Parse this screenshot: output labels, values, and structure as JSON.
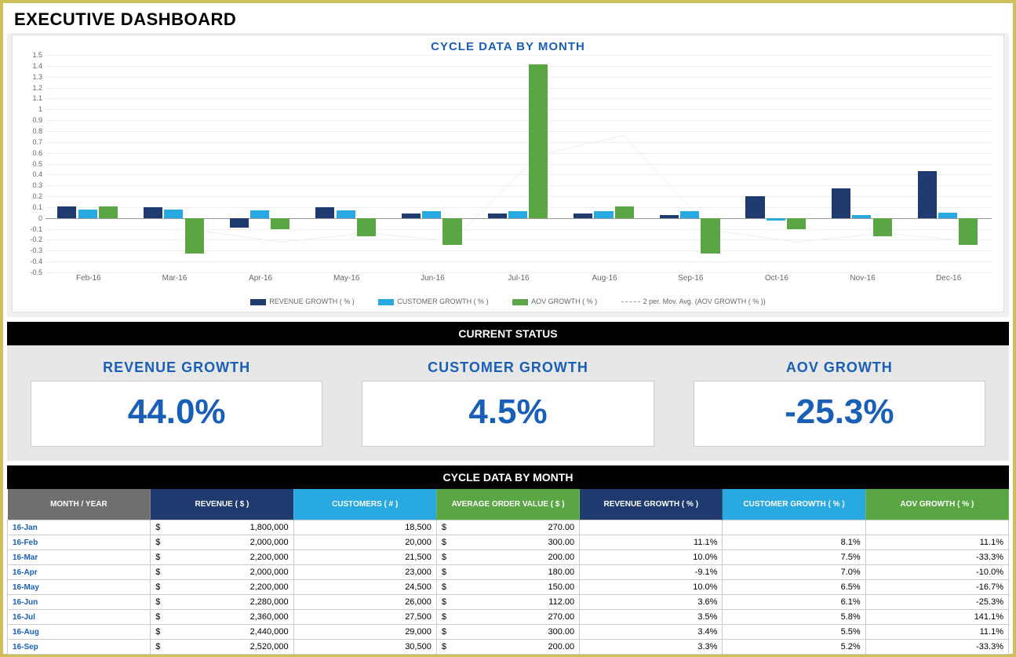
{
  "title": "EXECUTIVE DASHBOARD",
  "section_current": "CURRENT STATUS",
  "section_table": "CYCLE DATA BY MONTH",
  "chart_data": {
    "type": "bar",
    "title": "CYCLE DATA BY MONTH",
    "ylim": [
      -0.5,
      1.5
    ],
    "yticks": [
      -0.5,
      -0.4,
      -0.3,
      -0.2,
      -0.1,
      0,
      0.1,
      0.2,
      0.3,
      0.4,
      0.5,
      0.6,
      0.7,
      0.8,
      0.9,
      1,
      1.1,
      1.2,
      1.3,
      1.4,
      1.5
    ],
    "categories": [
      "Feb-16",
      "Mar-16",
      "Apr-16",
      "May-16",
      "Jun-16",
      "Jul-16",
      "Aug-16",
      "Sep-16",
      "Oct-16",
      "Nov-16",
      "Dec-16"
    ],
    "series": [
      {
        "name": "REVENUE GROWTH  ( % )",
        "color": "#1e3a6e",
        "values": [
          0.11,
          0.1,
          -0.09,
          0.1,
          0.04,
          0.04,
          0.04,
          0.03,
          0.2,
          0.27,
          0.43
        ]
      },
      {
        "name": "CUSTOMER GROWTH  ( % )",
        "color": "#29a9e1",
        "values": [
          0.08,
          0.08,
          0.07,
          0.07,
          0.06,
          0.06,
          0.06,
          0.06,
          -0.02,
          0.03,
          0.05
        ]
      },
      {
        "name": "AOV GROWTH  ( % )",
        "color": "#5aa644",
        "values": [
          0.11,
          -0.33,
          -0.1,
          -0.17,
          -0.25,
          1.41,
          0.11,
          -0.33,
          -0.1,
          -0.17,
          -0.25
        ]
      }
    ],
    "moving_avg": {
      "name": "2 per. Mov. Avg.  (AOV GROWTH  ( % ))",
      "values": [
        null,
        -0.11,
        -0.22,
        -0.14,
        -0.21,
        0.58,
        0.76,
        -0.11,
        -0.22,
        -0.14,
        -0.21
      ]
    },
    "legend": [
      "REVENUE GROWTH  ( % )",
      "CUSTOMER GROWTH  ( % )",
      "AOV GROWTH  ( % )",
      "2 per. Mov. Avg.  (AOV GROWTH  ( % ))"
    ]
  },
  "kpis": [
    {
      "label": "REVENUE GROWTH",
      "value": "44.0%"
    },
    {
      "label": "CUSTOMER GROWTH",
      "value": "4.5%"
    },
    {
      "label": "AOV GROWTH",
      "value": "-25.3%"
    }
  ],
  "table": {
    "headers": [
      {
        "text": "MONTH / YEAR",
        "bg": "#6f6f6f"
      },
      {
        "text": "REVENUE  ( $ )",
        "bg": "#1e3a6e"
      },
      {
        "text": "CUSTOMERS  ( # )",
        "bg": "#29a9e1"
      },
      {
        "text": "AVERAGE ORDER VALUE  ( $ )",
        "bg": "#5aa644"
      },
      {
        "text": "REVENUE GROWTH  ( % )",
        "bg": "#1e3a6e"
      },
      {
        "text": "CUSTOMER GROWTH  ( % )",
        "bg": "#29a9e1"
      },
      {
        "text": "AOV GROWTH  ( % )",
        "bg": "#5aa644"
      }
    ],
    "rows": [
      {
        "month": "16-Jan",
        "revenue": "1,800,000",
        "customers": "18,500",
        "aov": "270.00",
        "rg": "",
        "cg": "",
        "ag": ""
      },
      {
        "month": "16-Feb",
        "revenue": "2,000,000",
        "customers": "20,000",
        "aov": "300.00",
        "rg": "11.1%",
        "cg": "8.1%",
        "ag": "11.1%"
      },
      {
        "month": "16-Mar",
        "revenue": "2,200,000",
        "customers": "21,500",
        "aov": "200.00",
        "rg": "10.0%",
        "cg": "7.5%",
        "ag": "-33.3%"
      },
      {
        "month": "16-Apr",
        "revenue": "2,000,000",
        "customers": "23,000",
        "aov": "180.00",
        "rg": "-9.1%",
        "cg": "7.0%",
        "ag": "-10.0%"
      },
      {
        "month": "16-May",
        "revenue": "2,200,000",
        "customers": "24,500",
        "aov": "150.00",
        "rg": "10.0%",
        "cg": "6.5%",
        "ag": "-16.7%"
      },
      {
        "month": "16-Jun",
        "revenue": "2,280,000",
        "customers": "26,000",
        "aov": "112.00",
        "rg": "3.6%",
        "cg": "6.1%",
        "ag": "-25.3%"
      },
      {
        "month": "16-Jul",
        "revenue": "2,360,000",
        "customers": "27,500",
        "aov": "270.00",
        "rg": "3.5%",
        "cg": "5.8%",
        "ag": "141.1%"
      },
      {
        "month": "16-Aug",
        "revenue": "2,440,000",
        "customers": "29,000",
        "aov": "300.00",
        "rg": "3.4%",
        "cg": "5.5%",
        "ag": "11.1%"
      },
      {
        "month": "16-Sep",
        "revenue": "2,520,000",
        "customers": "30,500",
        "aov": "200.00",
        "rg": "3.3%",
        "cg": "5.2%",
        "ag": "-33.3%"
      }
    ]
  }
}
